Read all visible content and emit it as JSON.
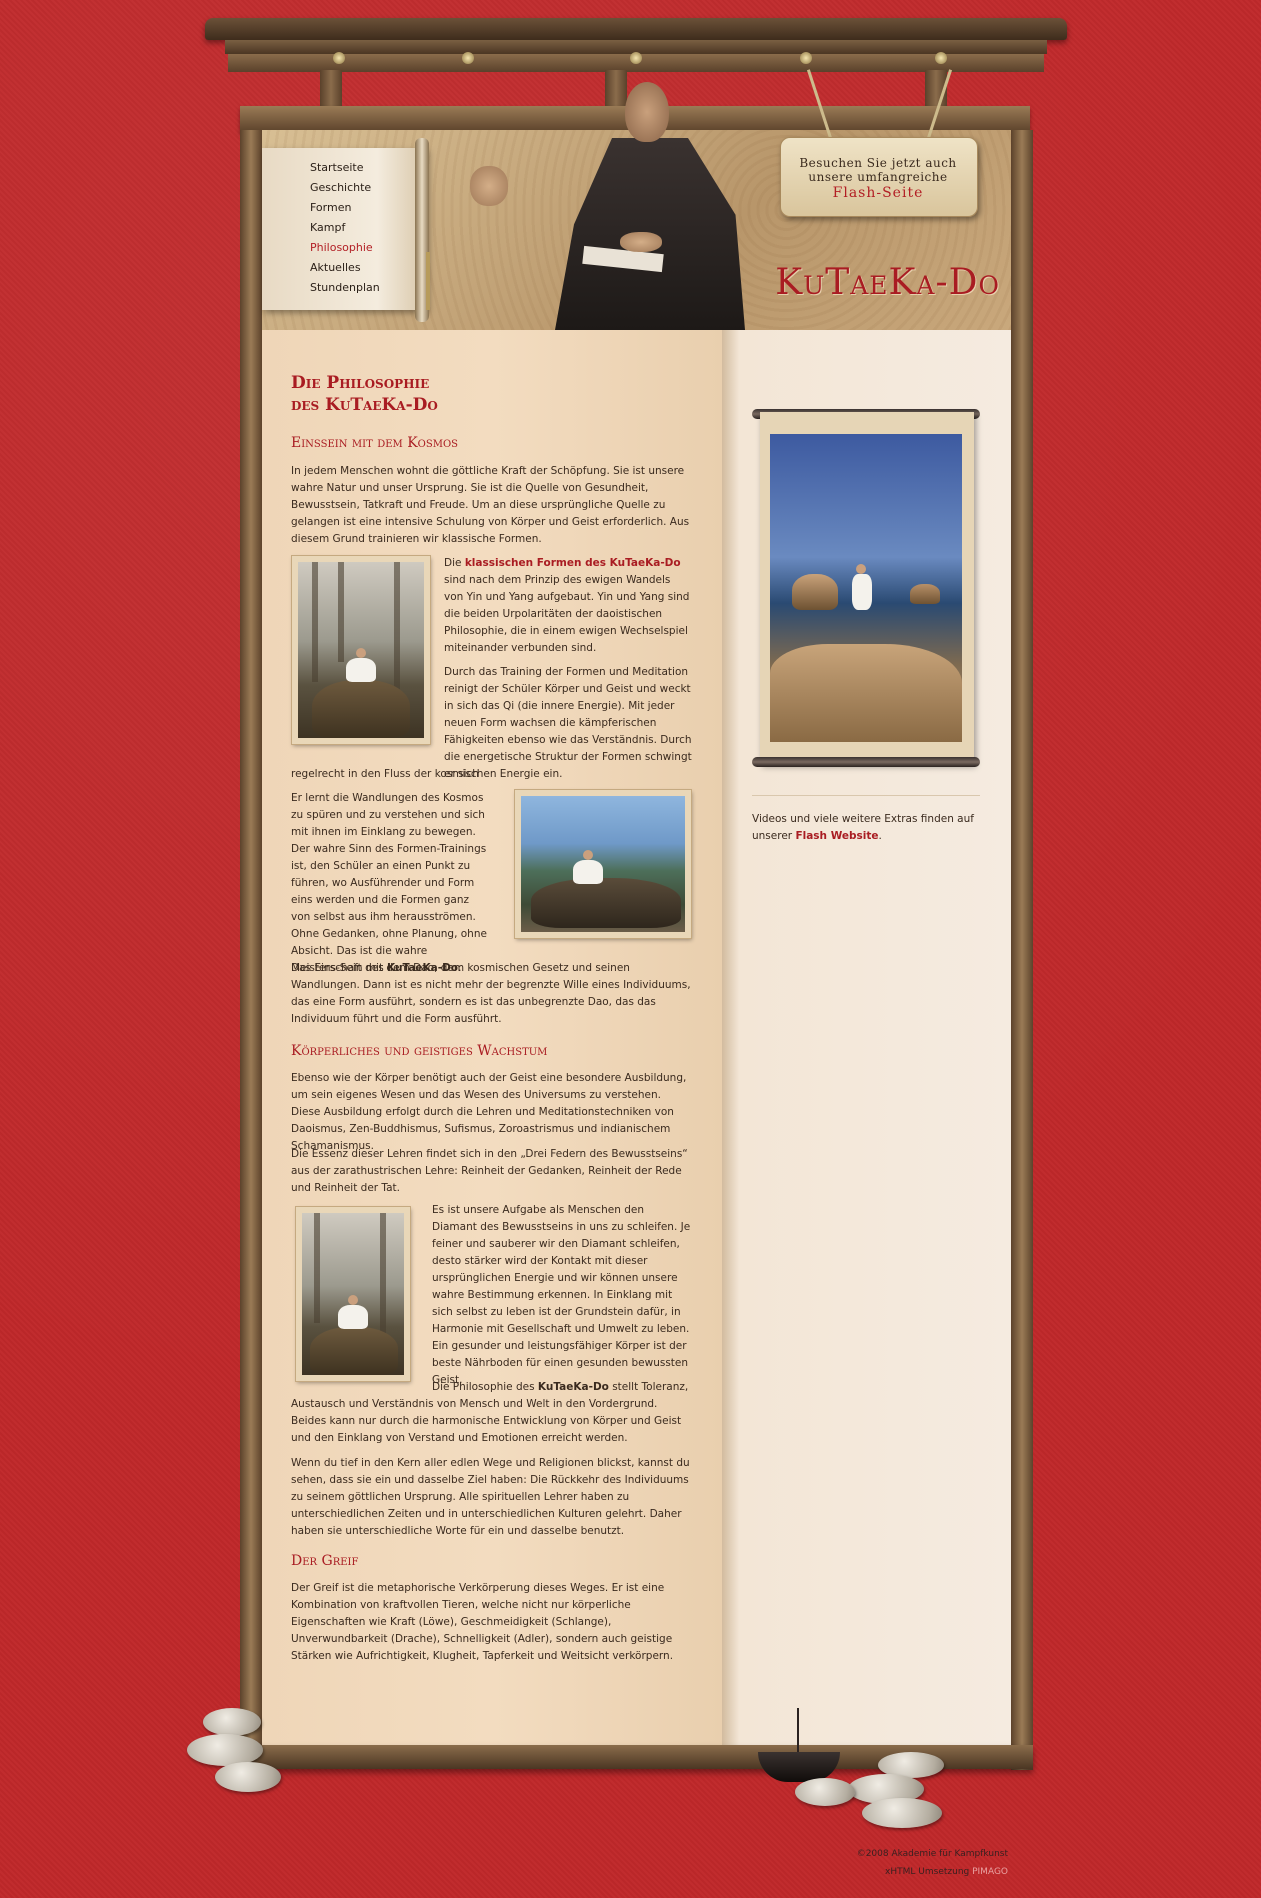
{
  "nav": {
    "items": [
      {
        "label": "Startseite",
        "active": false
      },
      {
        "label": "Geschichte",
        "active": false
      },
      {
        "label": "Formen",
        "active": false
      },
      {
        "label": "Kampf",
        "active": false
      },
      {
        "label": "Philosophie",
        "active": true
      },
      {
        "label": "Aktuelles",
        "active": false
      },
      {
        "label": "Stundenplan",
        "active": false
      }
    ]
  },
  "header": {
    "logo": "KuTaeKa-Do",
    "flash_sign": {
      "line1": "Besuchen Sie jetzt auch",
      "line2": "unsere umfangreiche",
      "line3": "Flash-Seite"
    }
  },
  "main": {
    "title_line1": "Die Philosophie",
    "title_line2": "des KuTaeKa-Do",
    "section1": {
      "heading": "Einssein mit dem Kosmos",
      "p1": "In jedem Menschen wohnt die göttliche Kraft der Schöpfung. Sie ist unsere wahre Natur und unser Ursprung. Sie ist die Quelle von Gesundheit, Bewusstsein, Tatkraft und Freude. Um an diese ursprüngliche Quelle zu gelangen ist eine intensive Schulung von Körper und Geist erforderlich. Aus diesem Grund trainieren wir klassische Formen.",
      "p2_pre": "Die ",
      "p2_bold": "klassischen Formen des KuTaeKa-Do",
      "p2_post": " sind nach dem Prinzip des ewigen Wandels von Yin und Yang aufgebaut. Yin und Yang sind die beiden Urpolaritäten der daoistischen Philosophie, die in einem ewigen Wechselspiel miteinander verbunden sind.",
      "p3": "Durch das Training der Formen und Meditation reinigt der Schüler Körper und Geist und weckt in sich das Qi (die innere Energie). Mit jeder neuen Form wachsen die kämpferischen Fähigkeiten ebenso wie das Verständnis. Durch die energetische Struktur der Formen schwingt er sich",
      "p3_cont": "regelrecht in den Fluss der kosmischen Energie ein.",
      "p4": "Er lernt die Wandlungen des Kosmos zu spüren und zu verstehen und sich mit ihnen im Einklang zu bewegen. Der wahre Sinn des Formen-Trainings ist, den Schüler an einen Punkt zu führen, wo Ausführender und Form eins werden und die Formen ganz von selbst aus ihm herausströmen. Ohne Gedanken, ohne Planung, ohne Absicht. Das ist die wahre Meisterschaft des",
      "p4_bold": "KuTaeKa-Do",
      "p4_colon": ":",
      "p4_cont": "Das Eins-Sein mit dem Dao, dem kosmischen Gesetz und seinen Wandlungen. Dann ist es nicht mehr der begrenzte Wille eines Individuums, das eine Form ausführt, sondern es ist das unbegrenzte Dao, das das Individuum führt und die Form ausführt."
    },
    "section2": {
      "heading": "Körperliches und geistiges Wachstum",
      "p1": "Ebenso wie der Körper benötigt auch der Geist eine besondere Ausbildung, um sein eigenes Wesen und das Wesen des Universums zu verstehen. Diese Ausbildung erfolgt durch die Lehren und Meditationstechniken von Daoismus, Zen-Buddhismus, Sufismus, Zoroastrismus und indianischem Schamanismus.",
      "p2": "Die Essenz dieser Lehren findet sich in den „Drei Federn des Bewusstseins“ aus der zarathustrischen Lehre: Reinheit der Gedanken, Reinheit der Rede und Reinheit der Tat.",
      "p3": "Es ist unsere Aufgabe als Menschen den Diamant des Bewusstseins in uns zu schleifen. Je feiner und sauberer wir den Diamant schleifen, desto stärker wird der Kontakt mit dieser ursprünglichen Energie und wir können unsere wahre Bestimmung erkennen. In Einklang mit sich selbst zu leben ist der Grundstein dafür, in Harmonie mit Gesellschaft und Umwelt zu leben. Ein gesunder und leistungsfähiger Körper ist der beste Nährboden für einen gesunden bewussten Geist.",
      "p4_pre": "Die Philosophie des ",
      "p4_bold": "KuTaeKa-Do",
      "p4_post": " stellt Toleranz,",
      "p4_cont": "Austausch und Verständnis von Mensch und Welt in den Vordergrund. Beides kann nur durch die harmonische Entwicklung von Körper und Geist und den Einklang von Verstand und Emotionen erreicht werden.",
      "p5": "Wenn du tief in den Kern aller edlen Wege und Religionen blickst, kannst du sehen, dass sie ein und dasselbe Ziel haben: Die Rückkehr des Individuums zu seinem göttlichen Ursprung. Alle spirituellen Lehrer haben zu unterschiedlichen Zeiten und in unterschiedlichen Kulturen gelehrt. Daher haben sie unterschiedliche Worte für ein und dasselbe benutzt."
    },
    "section3": {
      "heading": "Der Greif",
      "p1": "Der Greif ist die metaphorische Verkörperung dieses Weges. Er ist eine Kombination von kraftvollen Tieren, welche nicht nur körperliche Eigenschaften wie Kraft (Löwe), Geschmeidigkeit (Schlange), Unverwundbarkeit (Drache), Schnelligkeit (Adler), sondern auch geistige Stärken wie Aufrichtigkeit, Klugheit, Tapferkeit und Weitsicht verkörpern."
    }
  },
  "sidebar": {
    "text_pre": "Videos und viele weitere Extras finden auf unserer ",
    "link": "Flash Website",
    "text_post": "."
  },
  "footer": {
    "copyright": "©2008 Akademie für Kampfkunst",
    "credit_pre": "xHTML Umsetzung ",
    "credit_link": "PIMAGO"
  },
  "colors": {
    "background": "#c0282a",
    "accent": "#a91c22",
    "paper": "#f3dcc0"
  }
}
